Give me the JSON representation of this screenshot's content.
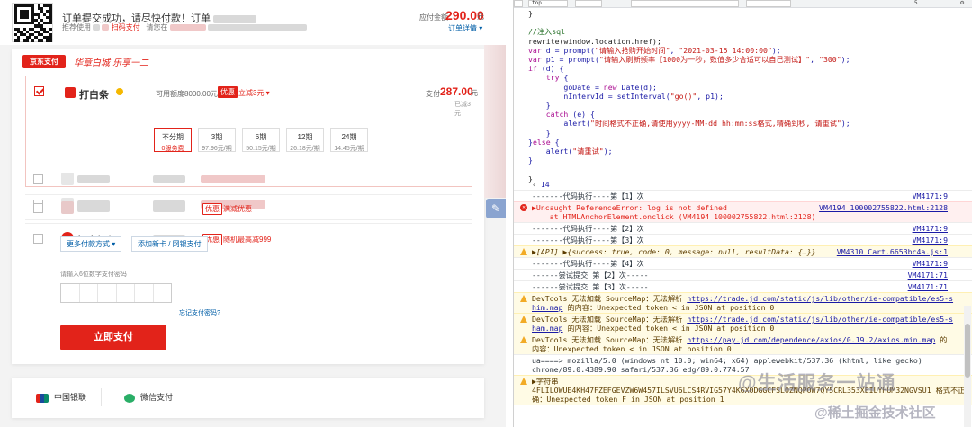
{
  "header": {
    "order_message": "订单提交成功，请尽快付款！订单",
    "sub_prefix": "推荐使用",
    "sub_link": "扫码支付",
    "sub_suffix": "请您在",
    "amount_label": "应付金额",
    "amount": "290.00",
    "amount_unit": "元",
    "order_detail": "订单详情 ▾"
  },
  "brand": {
    "logo": "京东支付",
    "slogan": "华章白城 乐享一二"
  },
  "baitiao": {
    "name": "打白条",
    "limit": "可用额度8000.00元",
    "tag": "优惠",
    "coupon": "立减3元 ▾",
    "pay_label": "支付",
    "pay_amount": "287.00",
    "pay_unit": "元",
    "saved": "已减3元",
    "terms": [
      {
        "line1": "不分期",
        "line2": "0服务费"
      },
      {
        "line1": "3期",
        "line2": "97.96元/期"
      },
      {
        "line1": "6期",
        "line2": "50.15元/期"
      },
      {
        "line1": "12期",
        "line2": "26.18元/期"
      },
      {
        "line1": "24期",
        "line2": "14.45元/期"
      }
    ]
  },
  "banks": [
    {
      "tag": "",
      "tag_text": ""
    },
    {
      "tag": "优惠",
      "tag_text": "满减优惠"
    },
    {
      "name": "招商银行",
      "tag": "优惠",
      "tag_text": "随机最高减999"
    }
  ],
  "actions": {
    "more_methods": "更多付款方式 ▾",
    "add_card": "添加新卡 / 网银支付",
    "pwd_label": "请输入6位数字支付密码",
    "forgot": "忘记支付密码?",
    "pay_button": "立即支付"
  },
  "bottom": {
    "unionpay": "中国银联",
    "wechat": "微信支付"
  },
  "devtools": {
    "frame": "top",
    "filter": "",
    "count": "5",
    "console": [
      {
        "kind": "result",
        "text": "14"
      },
      {
        "kind": "log",
        "text": "-------代码执行----第【1】次",
        "src": "VM4171:9"
      },
      {
        "kind": "error",
        "text": "▶Uncaught ReferenceError: log is not defined",
        "text2": "    at HTMLAnchorElement.onclick (VM4194 100002755822.html:2128)",
        "src": "VM4194 100002755822.html:2128"
      },
      {
        "kind": "log",
        "text": "-------代码执行----第【2】次",
        "src": "VM4171:9"
      },
      {
        "kind": "log",
        "text": "-------代码执行----第【3】次",
        "src": "VM4171:9"
      },
      {
        "kind": "warn-api",
        "text": "▶[API] ▶{success: true, code: 0, message: null, resultData: {…}}",
        "src": "VM4310 Cart.6653bc4a.js:1"
      },
      {
        "kind": "log",
        "text": "-------代码执行----第【4】次",
        "src": "VM4171:9"
      },
      {
        "kind": "log",
        "text": "------尝试提交 第【2】次-----",
        "src": "VM4171:71"
      },
      {
        "kind": "log",
        "text": "------尝试提交 第【3】次-----",
        "src": "VM4171:71"
      },
      {
        "kind": "warn",
        "text": "DevTools 无法加载 SourceMap：无法解析 ",
        "link": "https://trade.jd.com/static/js/lib/other/ie-compatible/es5-s",
        "text2": "him.map",
        "text3": " 的内容：Unexpected token < in JSON at position 0"
      },
      {
        "kind": "warn",
        "text": "DevTools 无法加载 SourceMap：无法解析 ",
        "link": "https://trade.jd.com/static/js/lib/other/ie-compatible/es5-s",
        "text2": "ham.map",
        "text3": " 的内容：Unexpected token < in JSON at position 0"
      },
      {
        "kind": "warn",
        "text": "DevTools 无法加载 SourceMap：无法解析 ",
        "link": "https://pay.jd.com/dependence/axios/0.19.2/axios.min.map",
        "text2": "",
        "text3": " 的",
        "text4": "内容：Unexpected token < in JSON at position 0"
      },
      {
        "kind": "log",
        "text": "ua====> mozilla/5.0 (windows nt 10.0; win64; x64) applewebkit/537.36 (khtml, like gecko)",
        "text2": "chrome/89.0.4389.90 safari/537.36 edg/89.0.774.57",
        "src": "VM4171:9"
      },
      {
        "kind": "warn",
        "text": "▶字符串",
        "text2": "",
        "text3": "",
        "text4": "4FLILOWUE4KH47FZEFGEVZW6W457ILSVU6LCS4RVIG57Y4K6XODGGCFSLOZNQPOW7QY5CRL353XEILYHUM32NGVSU1 格式不正",
        "text5": "确：Unexpected token F in JSON at position 1"
      }
    ]
  },
  "watermark": {
    "line1": "@生活服务一站通",
    "line2": "@稀土掘金技术社区"
  }
}
